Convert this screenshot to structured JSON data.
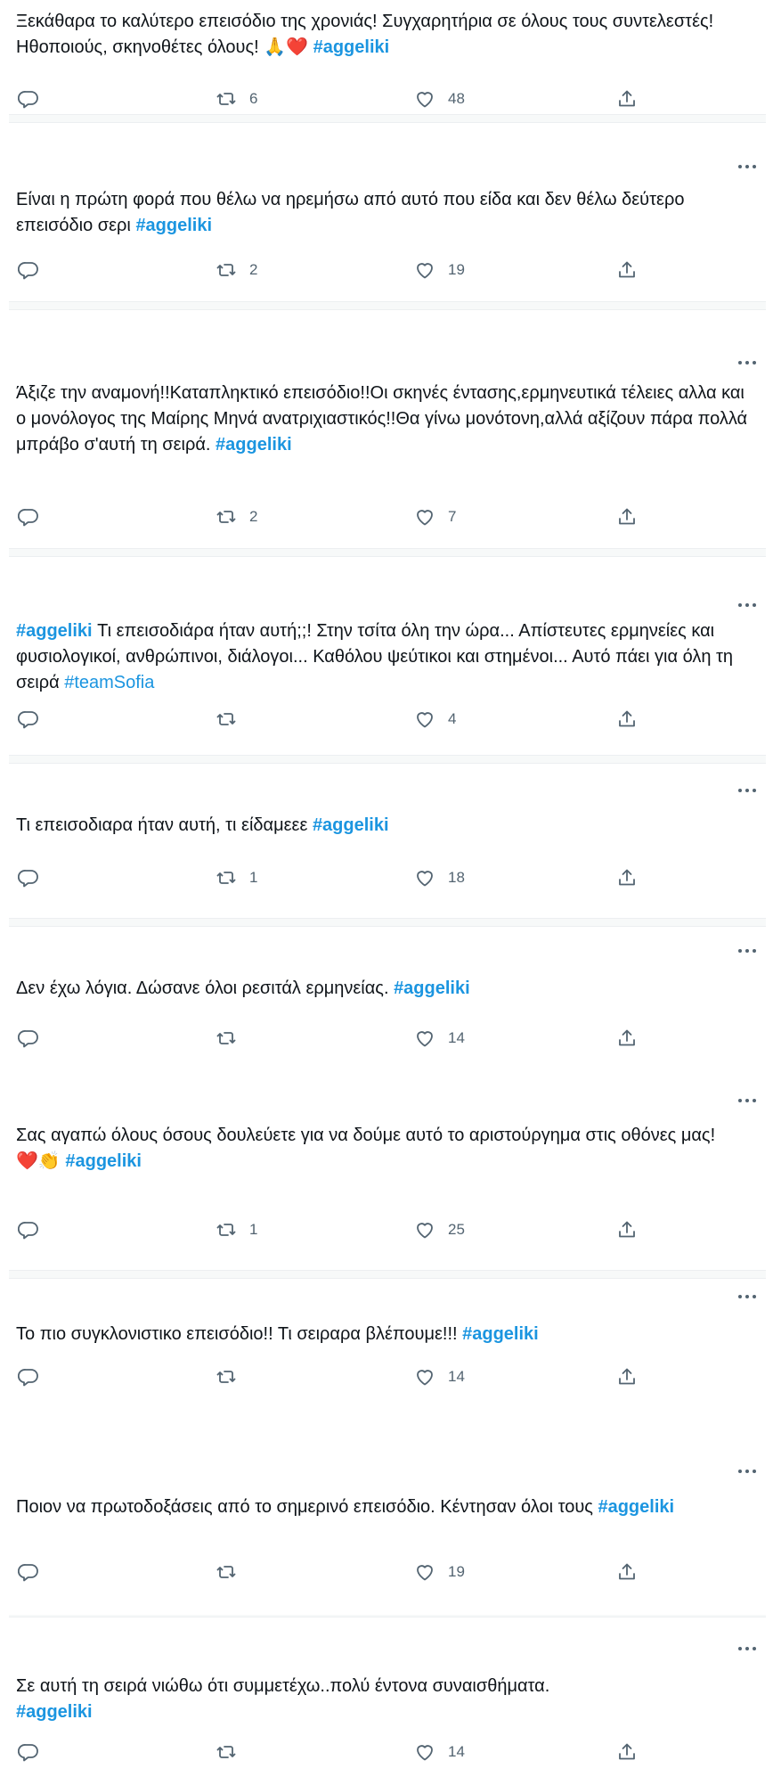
{
  "theme": {
    "text": "#0f1419",
    "accent": "#1b95e0",
    "icon": "#536471",
    "heart": "#e0245e"
  },
  "tweets": [
    {
      "parts": [
        {
          "t": "Ξεκάθαρα το καλύτερο επεισόδιο της χρονιάς! Συγχαρητήρια σε όλους τους συντελεστές! Ηθοποιούς, σκηνοθέτες όλους! "
        },
        {
          "t": "🙏❤️",
          "c": "emo"
        },
        {
          "t": " "
        },
        {
          "t": "#aggeliki",
          "c": "hl"
        }
      ],
      "retweets": "6",
      "likes": "48"
    },
    {
      "parts": [
        {
          "t": "Είναι η πρώτη φορά που θέλω να ηρεμήσω από αυτό που είδα και δεν θέλω δεύτερο επεισόδιο σερι "
        },
        {
          "t": "#aggeliki",
          "c": "hl"
        }
      ],
      "retweets": "2",
      "likes": "19"
    },
    {
      "parts": [
        {
          "t": "Άξιζε την αναμονή!!Καταπληκτικό επεισόδιο!!Οι σκηνές έντασης,ερμηνευτικά τέλειες αλλα και ο μονόλογος της Μαίρης Μηνά ανατριχιαστικός!!Θα γίνω μονότονη,αλλά αξίζουν πάρα πολλά μπράβο σ'αυτή τη σειρά. "
        },
        {
          "t": "#aggeliki",
          "c": "hl"
        }
      ],
      "retweets": "2",
      "likes": "7"
    },
    {
      "parts": [
        {
          "t": "#aggeliki",
          "c": "hl"
        },
        {
          "t": " Τι επεισοδιάρα ήταν αυτή;;! Στην τσίτα όλη την ώρα... Απίστευτες ερμηνείες και φυσιολογικοί, ανθρώπινοι,  διάλογοι... Καθόλου ψεύτικοι και στημένοι... Αυτό πάει για όλη τη σειρά "
        },
        {
          "t": "#teamSofia",
          "c": "hl2"
        }
      ],
      "retweets": "",
      "likes": "4"
    },
    {
      "parts": [
        {
          "t": "Τι επεισοδιαρα ήταν αυτή, τι είδαμεεε "
        },
        {
          "t": "#aggeliki",
          "c": "hl"
        }
      ],
      "retweets": "1",
      "likes": "18"
    },
    {
      "parts": [
        {
          "t": "Δεν έχω λόγια. Δώσανε όλοι ρεσιτάλ ερμηνείας. "
        },
        {
          "t": "#aggeliki",
          "c": "hl"
        }
      ],
      "retweets": "",
      "likes": "14"
    },
    {
      "parts": [
        {
          "t": "Σας αγαπώ όλους όσους δουλεύετε για να δούμε αυτό το αριστούργημα στις οθόνες μας!"
        },
        {
          "br": true
        },
        {
          "t": "❤️👏",
          "c": "emo"
        },
        {
          "t": " "
        },
        {
          "t": "#aggeliki",
          "c": "hl"
        }
      ],
      "retweets": "1",
      "likes": "25"
    },
    {
      "parts": [
        {
          "t": "Το πιο συγκλονιστικο επεισόδιο!! Τι σειραρα βλέπουμε!!! "
        },
        {
          "t": "#aggeliki",
          "c": "hl"
        }
      ],
      "retweets": "",
      "likes": "14"
    },
    {
      "parts": [
        {
          "t": "Ποιον να πρωτοδοξάσεις από το σημερινό επεισόδιο. Κέντησαν όλοι τους "
        },
        {
          "t": "#aggeliki",
          "c": "hl"
        }
      ],
      "retweets": "",
      "likes": "19"
    },
    {
      "parts": [
        {
          "t": "Σε αυτή τη σειρά νιώθω ότι συμμετέχω..πολύ έντονα συναισθήματα."
        },
        {
          "br": true
        },
        {
          "t": "#aggeliki",
          "c": "hl"
        }
      ],
      "retweets": "",
      "likes": "14"
    }
  ]
}
